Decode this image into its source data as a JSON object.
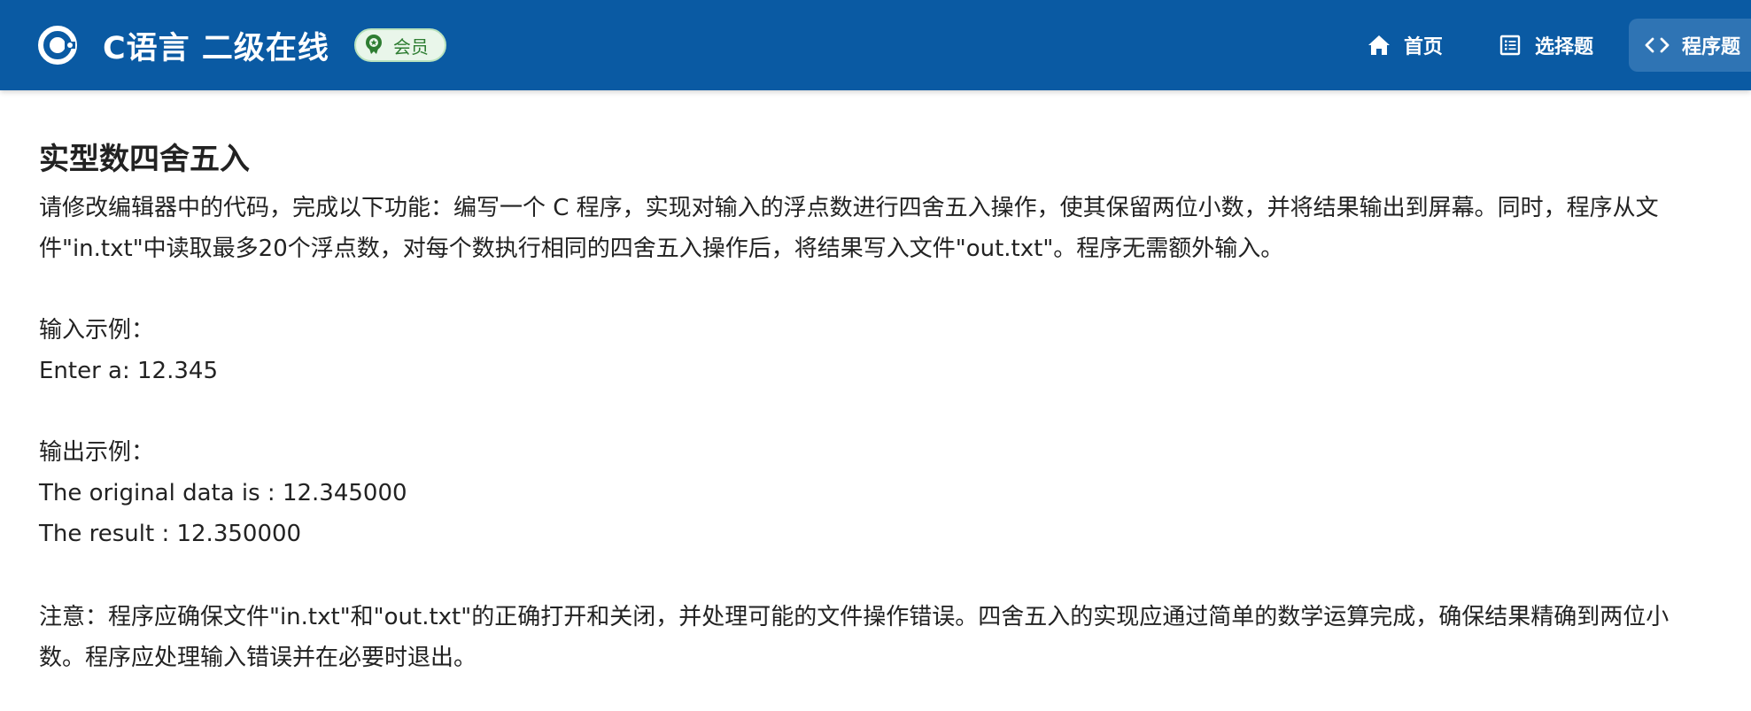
{
  "header": {
    "app_title": "C语言 二级在线",
    "member_badge": "会员",
    "logo_icon": "c-logo-icon",
    "brand_color": "#0a5aa3"
  },
  "nav": {
    "items": [
      {
        "label": "首页",
        "icon": "home-icon"
      },
      {
        "label": "选择题",
        "icon": "list-icon"
      },
      {
        "label": "程序题",
        "icon": "code-icon",
        "active": true
      }
    ]
  },
  "problem": {
    "title": "实型数四舍五入",
    "description": "请修改编辑器中的代码，完成以下功能：编写一个 C 程序，实现对输入的浮点数进行四舍五入操作，使其保留两位小数，并将结果输出到屏幕。同时，程序从文件\"in.txt\"中读取最多20个浮点数，对每个数执行相同的四舍五入操作后，将结果写入文件\"out.txt\"。程序无需额外输入。",
    "input_example_label": "输入示例：",
    "input_example_line": "Enter a: 12.345",
    "output_example_label": "输出示例：",
    "output_example_lines": [
      "The original data is : 12.345000",
      "The result : 12.350000"
    ],
    "note": "注意：程序应确保文件\"in.txt\"和\"out.txt\"的正确打开和关闭，并处理可能的文件操作错误。四舍五入的实现应通过简单的数学运算完成，确保结果精确到两位小数。程序应处理输入错误并在必要时退出。"
  }
}
